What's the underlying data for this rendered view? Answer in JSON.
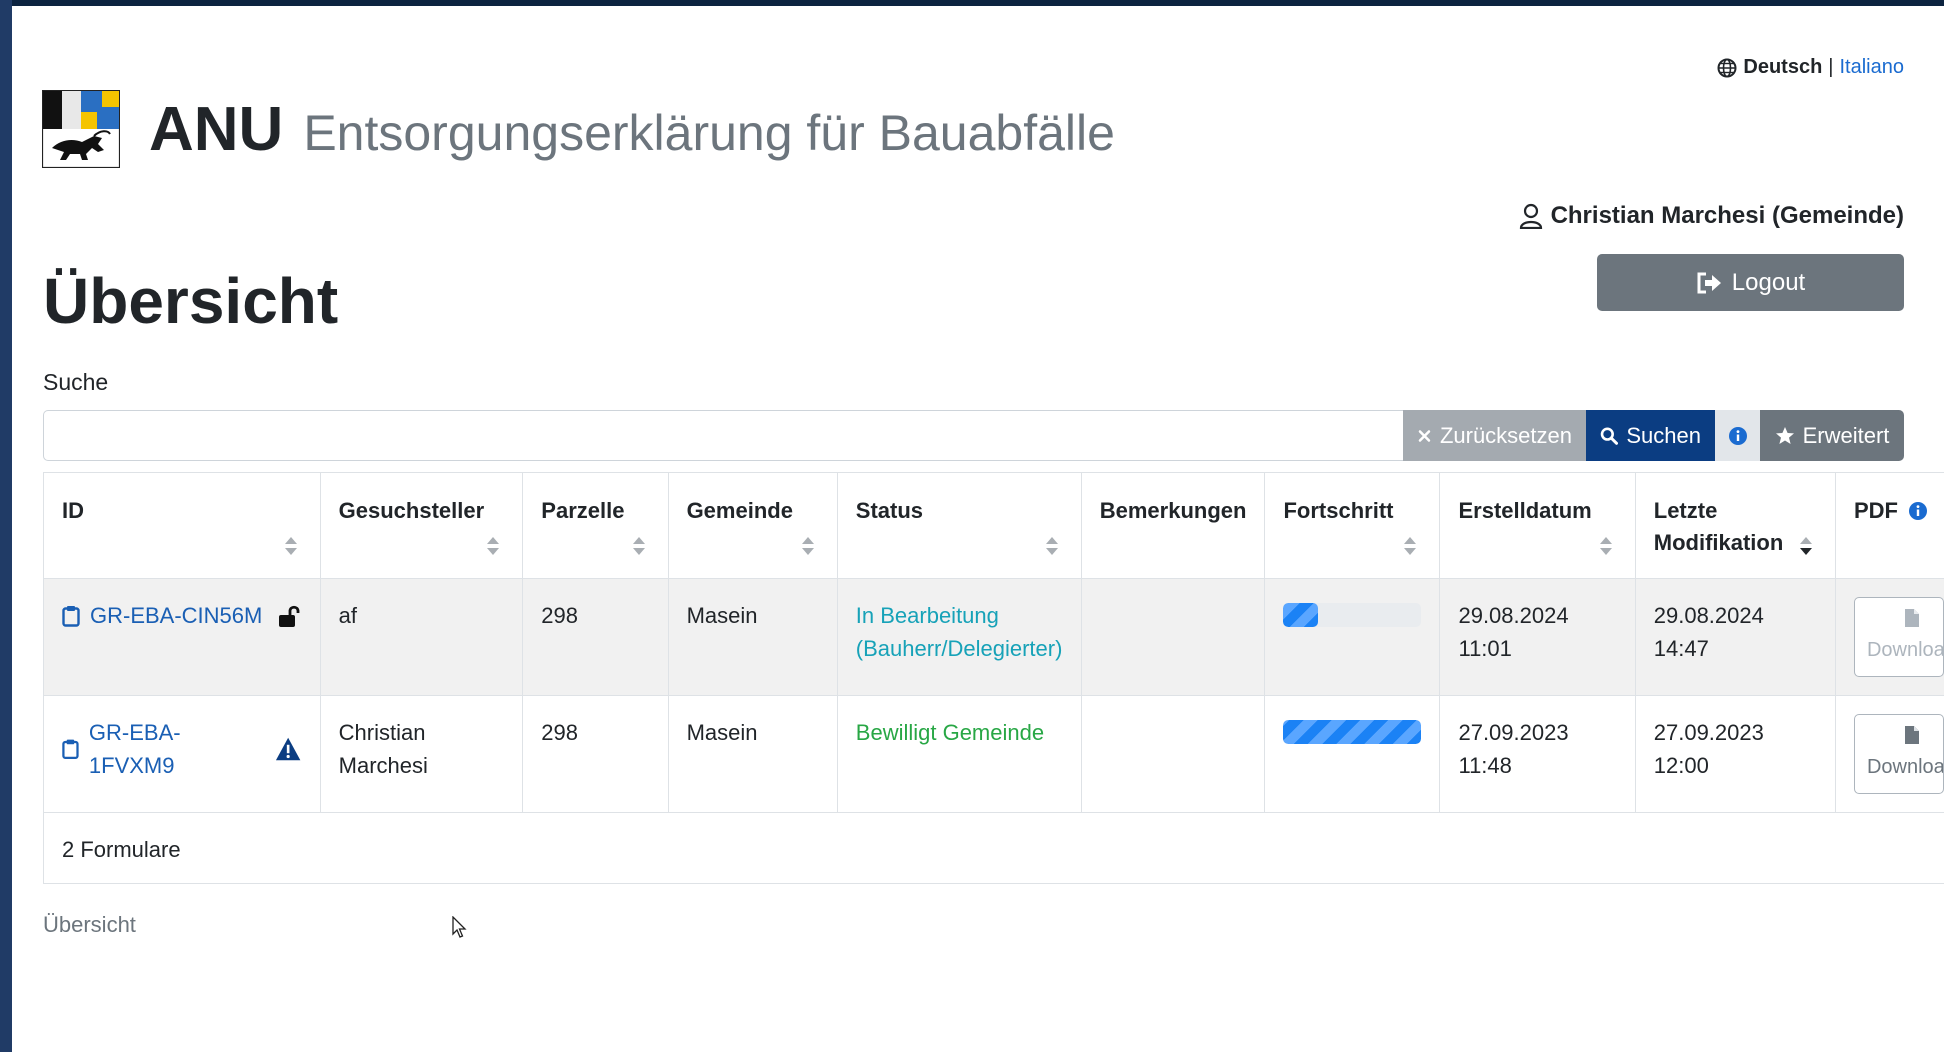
{
  "language": {
    "active": "Deutsch",
    "separator": "|",
    "other": "Italiano"
  },
  "header": {
    "app": "ANU",
    "subtitle": "Entsorgungserklärung für Bauabfälle"
  },
  "user": {
    "name": "Christian Marchesi (Gemeinde)"
  },
  "logout_label": "Logout",
  "page_title": "Übersicht",
  "search": {
    "label": "Suche",
    "value": "",
    "placeholder": "",
    "reset_label": "Zurücksetzen",
    "search_label": "Suchen",
    "extended_label": "Erweitert"
  },
  "table": {
    "columns": [
      "ID",
      "Gesuchsteller",
      "Parzelle",
      "Gemeinde",
      "Status",
      "Bemerkungen",
      "Fortschritt",
      "Erstelldatum",
      "Letzte Modifikation",
      "PDF"
    ],
    "rows": [
      {
        "id": "GR-EBA-CIN56M",
        "id_icon": "unlock-icon",
        "gesuchsteller": "af",
        "parzelle": "298",
        "gemeinde": "Masein",
        "status": "In Bearbeitung (Bauherr/Delegierter)",
        "status_color": "#17a2b8",
        "bemerkungen": "",
        "progress": 0.25,
        "erstelldatum": "29.08.2024",
        "erstellzeit": "11:01",
        "modifikation_datum": "29.08.2024",
        "modifikation_zeit": "14:47",
        "pdf_label": "Download",
        "pdf_enabled": false
      },
      {
        "id": "GR-EBA-1FVXM9",
        "id_icon": "warning-icon",
        "gesuchsteller": "Christian Marchesi",
        "parzelle": "298",
        "gemeinde": "Masein",
        "status": "Bewilligt Gemeinde",
        "status_color": "#28a745",
        "bemerkungen": "",
        "progress": 1.0,
        "erstelldatum": "27.09.2023",
        "erstellzeit": "11:48",
        "modifikation_datum": "27.09.2023",
        "modifikation_zeit": "12:00",
        "pdf_label": "Download",
        "pdf_enabled": true
      }
    ],
    "footer": "2 Formulare"
  },
  "breadcrumb": "Übersicht",
  "colors": {
    "primary": "#0b3d82",
    "link": "#1a5fb4",
    "secondary": "#6c757d",
    "progress": "#1b82f5"
  }
}
